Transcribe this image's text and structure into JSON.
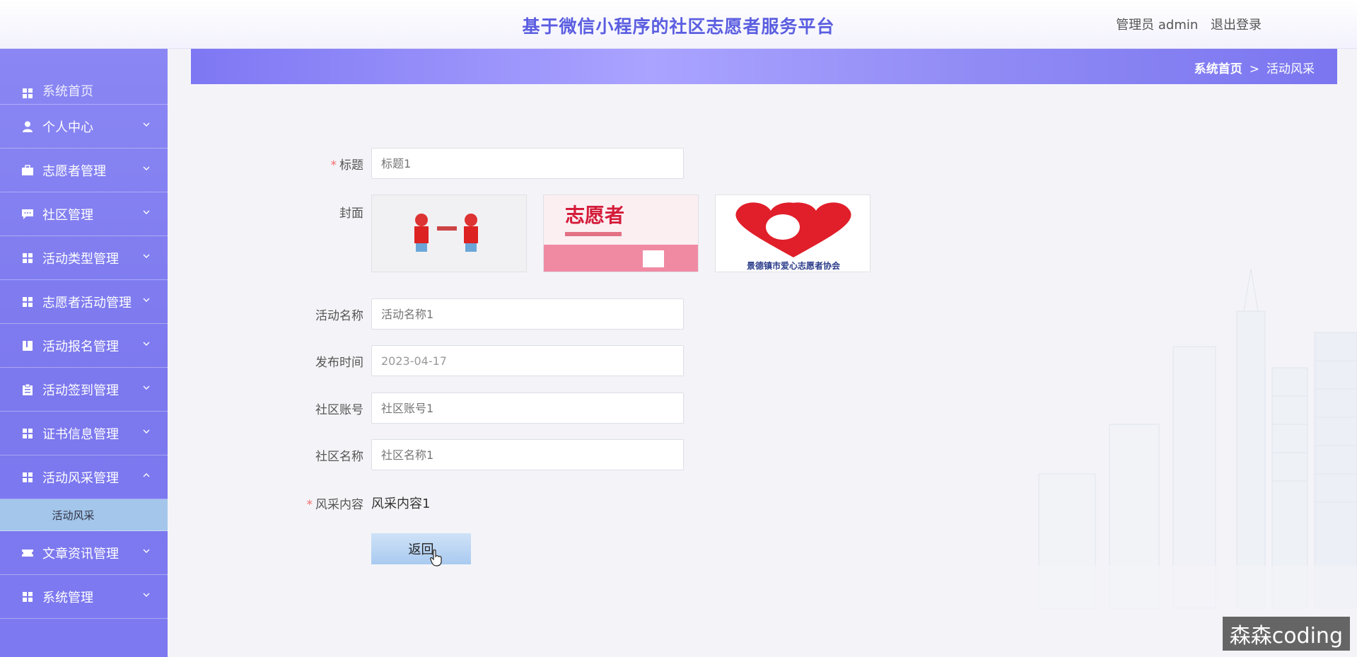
{
  "header": {
    "title": "基于微信小程序的社区志愿者服务平台",
    "user_label": "管理员 admin",
    "logout_label": "退出登录"
  },
  "sidebar": {
    "items": [
      {
        "label": "系统首页",
        "icon": "grid-icon"
      },
      {
        "label": "个人中心",
        "icon": "user-icon"
      },
      {
        "label": "志愿者管理",
        "icon": "briefcase-icon"
      },
      {
        "label": "社区管理",
        "icon": "chat-icon"
      },
      {
        "label": "活动类型管理",
        "icon": "grid-icon"
      },
      {
        "label": "志愿者活动管理",
        "icon": "grid-icon"
      },
      {
        "label": "活动报名管理",
        "icon": "book-icon"
      },
      {
        "label": "活动签到管理",
        "icon": "clipboard-icon"
      },
      {
        "label": "证书信息管理",
        "icon": "grid-icon"
      },
      {
        "label": "活动风采管理",
        "icon": "grid-icon",
        "expanded": true
      },
      {
        "label": "文章资讯管理",
        "icon": "ticket-icon"
      },
      {
        "label": "系统管理",
        "icon": "grid-icon"
      }
    ],
    "active_sub": "活动风采"
  },
  "breadcrumb": {
    "home": "系统首页",
    "separator": ">",
    "current": "活动风采"
  },
  "form": {
    "title": {
      "label": "标题",
      "required": true,
      "placeholder": "标题1"
    },
    "cover": {
      "label": "封面",
      "image_texts": [
        "志愿者",
        "景德镇市爱心志愿者协会"
      ]
    },
    "activity_name": {
      "label": "活动名称",
      "placeholder": "活动名称1"
    },
    "publish_time": {
      "label": "发布时间",
      "value": "2023-04-17"
    },
    "community_account": {
      "label": "社区账号",
      "placeholder": "社区账号1"
    },
    "community_name": {
      "label": "社区名称",
      "placeholder": "社区名称1"
    },
    "content": {
      "label": "风采内容",
      "required": true,
      "value": "风采内容1"
    },
    "back_label": "返回"
  },
  "watermark": "森森coding",
  "colors": {
    "accent": "#5b5ee0",
    "sidebar": "#7c78ee",
    "required": "#f56c6c",
    "submenu_active": "#a3c6ea"
  }
}
